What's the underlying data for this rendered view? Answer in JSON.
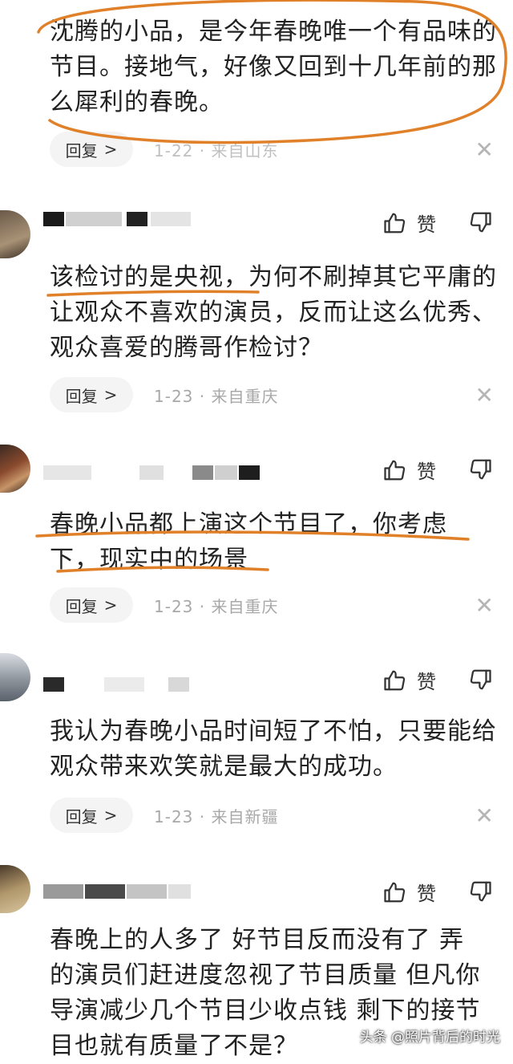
{
  "comments": [
    {
      "text": "沈腾的小品，是今年春晚唯一个有品味的节目。接地气，好像又回到十几年前的那么犀利的春晚。",
      "reply_label": "回复",
      "meta": "1-22 · 来自山东"
    },
    {
      "like_label": "赞",
      "text": "该检讨的是央视，为何不刷掉其它平庸的让观众不喜欢的演员，反而让这么优秀、观众喜爱的腾哥作检讨？",
      "reply_label": "回复",
      "meta": "1-23 · 来自重庆"
    },
    {
      "like_label": "赞",
      "text": "春晚小品都上演这个节目了，你考虑下，现实中的场景",
      "reply_label": "回复",
      "meta": "1-23 · 来自重庆"
    },
    {
      "like_label": "赞",
      "text": "我认为春晚小品时间短了不怕，只要能给观众带来欢笑就是最大的成功。",
      "reply_label": "回复",
      "meta": "1-23 · 来自新疆"
    },
    {
      "like_label": "赞",
      "text": "春晚上的人多了 好节目反而没有了 弄的演员们赶进度忽视了节目质量 但凡你导演减少几个节目少收点钱 剩下的接节目也就有质量了不是？"
    }
  ],
  "watermark": "头条 @照片背后的时光",
  "colors": {
    "annotation": "#E0812A",
    "meta": "#a8a8a8",
    "reply_bg": "#f4f4f4"
  }
}
